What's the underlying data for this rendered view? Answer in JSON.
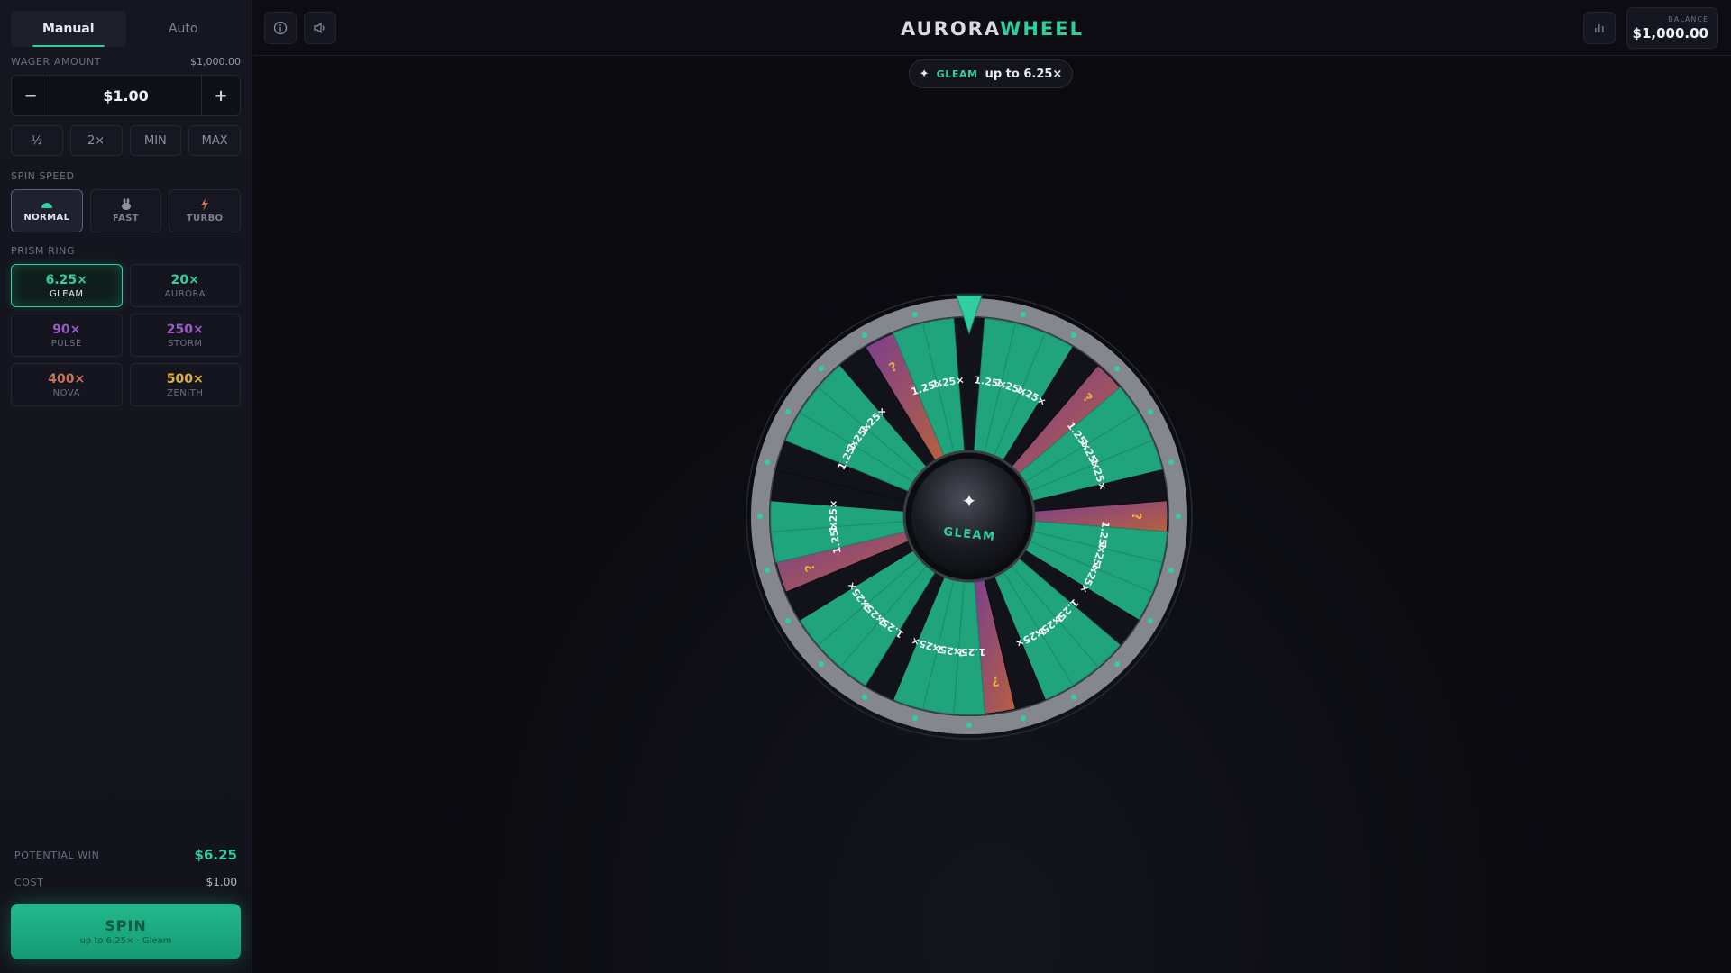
{
  "sidebar": {
    "tabs": [
      {
        "label": "Manual",
        "active": true
      },
      {
        "label": "Auto",
        "active": false
      }
    ],
    "wager": {
      "label": "WAGER AMOUNT",
      "max_note": "$1,000.00",
      "minus": "−",
      "value": "$1.00",
      "plus": "+",
      "quick": [
        "½",
        "2×",
        "MIN",
        "MAX"
      ]
    },
    "speed": {
      "label": "SPIN SPEED",
      "options": [
        {
          "label": "NORMAL",
          "icon": "gauge-icon",
          "active": true
        },
        {
          "label": "FAST",
          "icon": "rabbit-icon",
          "active": false
        },
        {
          "label": "TURBO",
          "icon": "lightning-icon",
          "active": false
        }
      ]
    },
    "rings": {
      "label": "PRISM RING",
      "options": [
        {
          "mult": "6.25×",
          "name": "GLEAM",
          "color": "#2fcf9f",
          "active": true
        },
        {
          "mult": "20×",
          "name": "AURORA",
          "color": "#2fcf9f",
          "active": false
        },
        {
          "mult": "90×",
          "name": "PULSE",
          "color": "#9b5cc4",
          "active": false
        },
        {
          "mult": "250×",
          "name": "STORM",
          "color": "#9b5cc4",
          "active": false
        },
        {
          "mult": "400×",
          "name": "NOVA",
          "color": "#c8735a",
          "active": false
        },
        {
          "mult": "500×",
          "name": "ZENITH",
          "color": "#e0b13c",
          "active": false
        }
      ]
    },
    "summary": {
      "win_label": "POTENTIAL WIN",
      "win_value": "$6.25",
      "cost_label": "COST",
      "cost_value": "$1.00"
    },
    "spin": {
      "title": "SPIN",
      "subtitle": "up to 6.25× · Gleam"
    }
  },
  "header": {
    "brand_a": "AURORA",
    "brand_b": "WHEEL",
    "balance_label": "BALANCE",
    "balance_value": "$1,000.00",
    "icons": [
      "info-icon",
      "sound-icon",
      "stats-icon"
    ]
  },
  "main": {
    "pill": {
      "icon": "sparkle-icon",
      "name": "GLEAM",
      "mult": "up to 6.25×"
    },
    "wheel": {
      "hub_label": "GLEAM",
      "segment_label": "1.25×",
      "mystery_label": "?",
      "colors": {
        "green": "#20a47c",
        "dark": "#12131a",
        "purple": "#7b3f8f",
        "rim": "#8a8c93"
      }
    }
  }
}
